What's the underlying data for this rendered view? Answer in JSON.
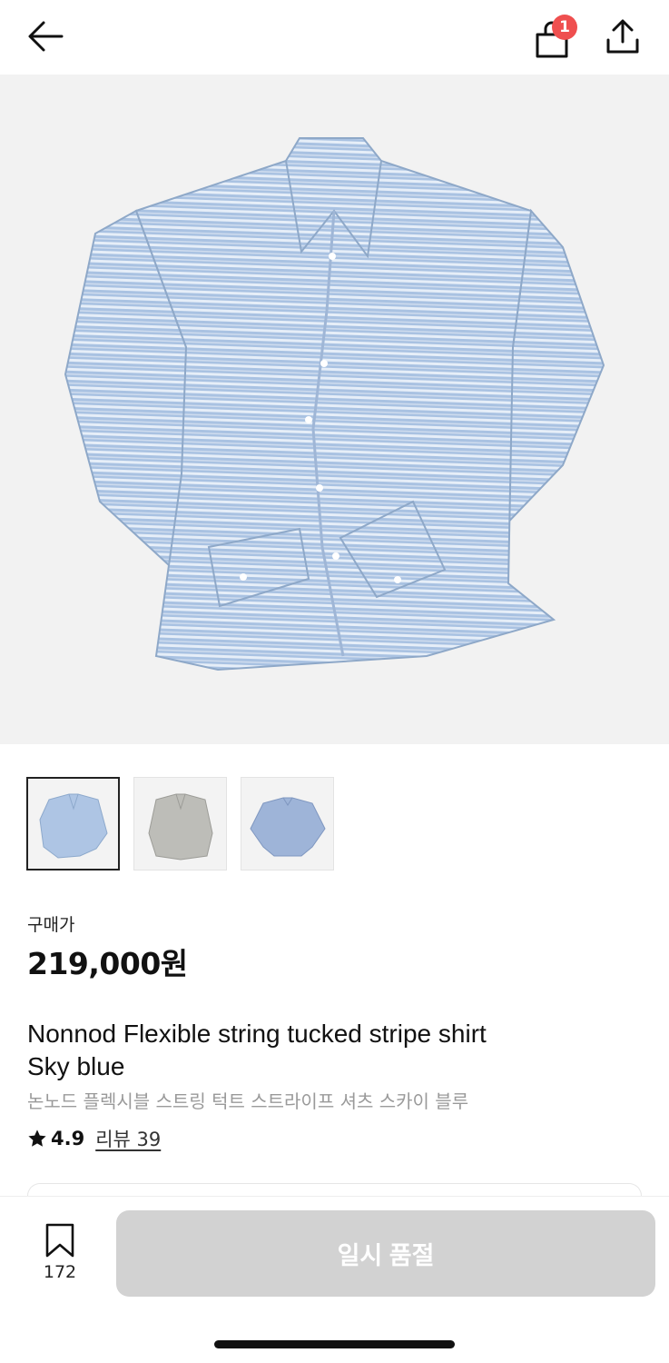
{
  "header": {
    "back_icon": "arrow-left-icon",
    "cart_icon": "shopping-bag-icon",
    "cart_badge": "1",
    "share_icon": "share-upload-icon",
    "badge_color": "#ef4f4f"
  },
  "gallery": {
    "thumbnails": [
      "thumbnail-sky-blue-shirt",
      "thumbnail-grey-shirt",
      "thumbnail-blue-shirt-back"
    ],
    "selected_index": 0
  },
  "product": {
    "price_label": "구매가",
    "price": "219,000원",
    "title_en_line1": "Nonnod Flexible string tucked stripe shirt",
    "title_en_line2": "Sky blue",
    "title_ko": "논노드 플렉시블 스트링 턱트 스트라이프 셔츠 스카이 블루",
    "rating": "4.9",
    "review_link": "리뷰 39"
  },
  "footer": {
    "wishlist_icon": "bookmark-icon",
    "wishlist_count": "172",
    "soldout_label": "일시 품절",
    "button_color": "#d2d2d2"
  }
}
